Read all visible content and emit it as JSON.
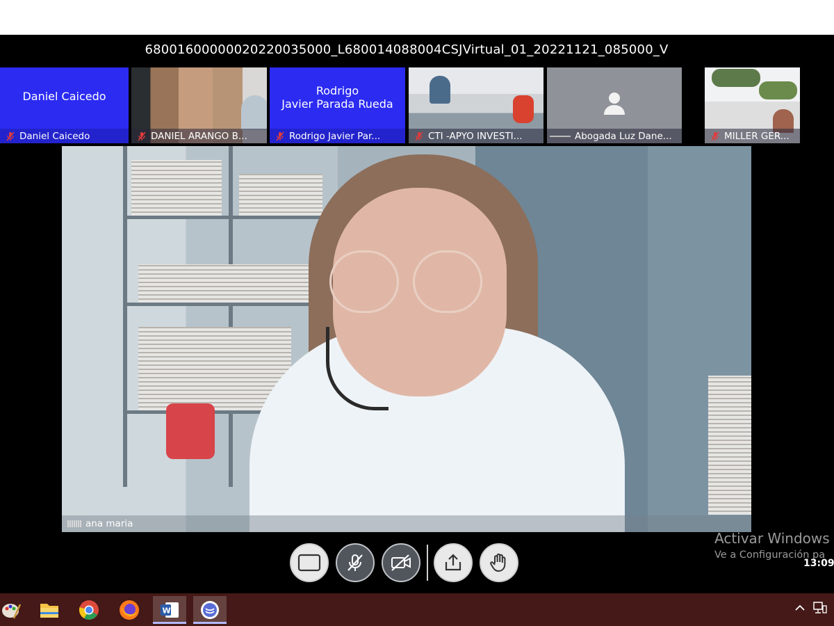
{
  "meeting": {
    "title": "68001600000020220035000_L680014088004CSJVirtual_01_20221121_085000_V"
  },
  "participants": [
    {
      "tile_name": "Daniel Caicedo",
      "label": "Daniel Caicedo",
      "type": "avatar-blue"
    },
    {
      "tile_name": "",
      "label": "DANIEL ARANGO B...",
      "type": "video"
    },
    {
      "tile_name_line1": "Rodrigo",
      "tile_name_line2": "Javier Parada Rueda",
      "label": "Rodrigo Javier Par...",
      "type": "avatar-blue"
    },
    {
      "tile_name": "",
      "label": "CTI -APYO INVESTI...",
      "type": "video"
    },
    {
      "tile_name": "",
      "label": "Abogada Luz Dane...",
      "type": "placeholder",
      "icon": "person-icon"
    },
    {
      "tile_name": "",
      "label": "MILLER GER...",
      "type": "video"
    }
  ],
  "main_speaker": {
    "label": "ana maria"
  },
  "controls": [
    {
      "name": "screen-layout",
      "icon": "screen-icon"
    },
    {
      "name": "microphone",
      "icon": "mic-off-icon"
    },
    {
      "name": "camera",
      "icon": "camera-off-icon"
    },
    {
      "name": "share",
      "icon": "share-upload-icon"
    },
    {
      "name": "raise-hand",
      "icon": "hand-icon"
    }
  ],
  "watermark": {
    "title": "Activar Windows",
    "subtitle": "Ve a Configuración pa"
  },
  "clock": "13:09",
  "taskbar": {
    "apps": [
      "paint-icon",
      "file-explorer-icon",
      "chrome-icon",
      "firefox-icon",
      "word-icon",
      "lifesize-icon"
    ]
  },
  "colors": {
    "tile_blue": "#2b2bf2",
    "taskbar": "#441917",
    "app_background": "#000000"
  }
}
